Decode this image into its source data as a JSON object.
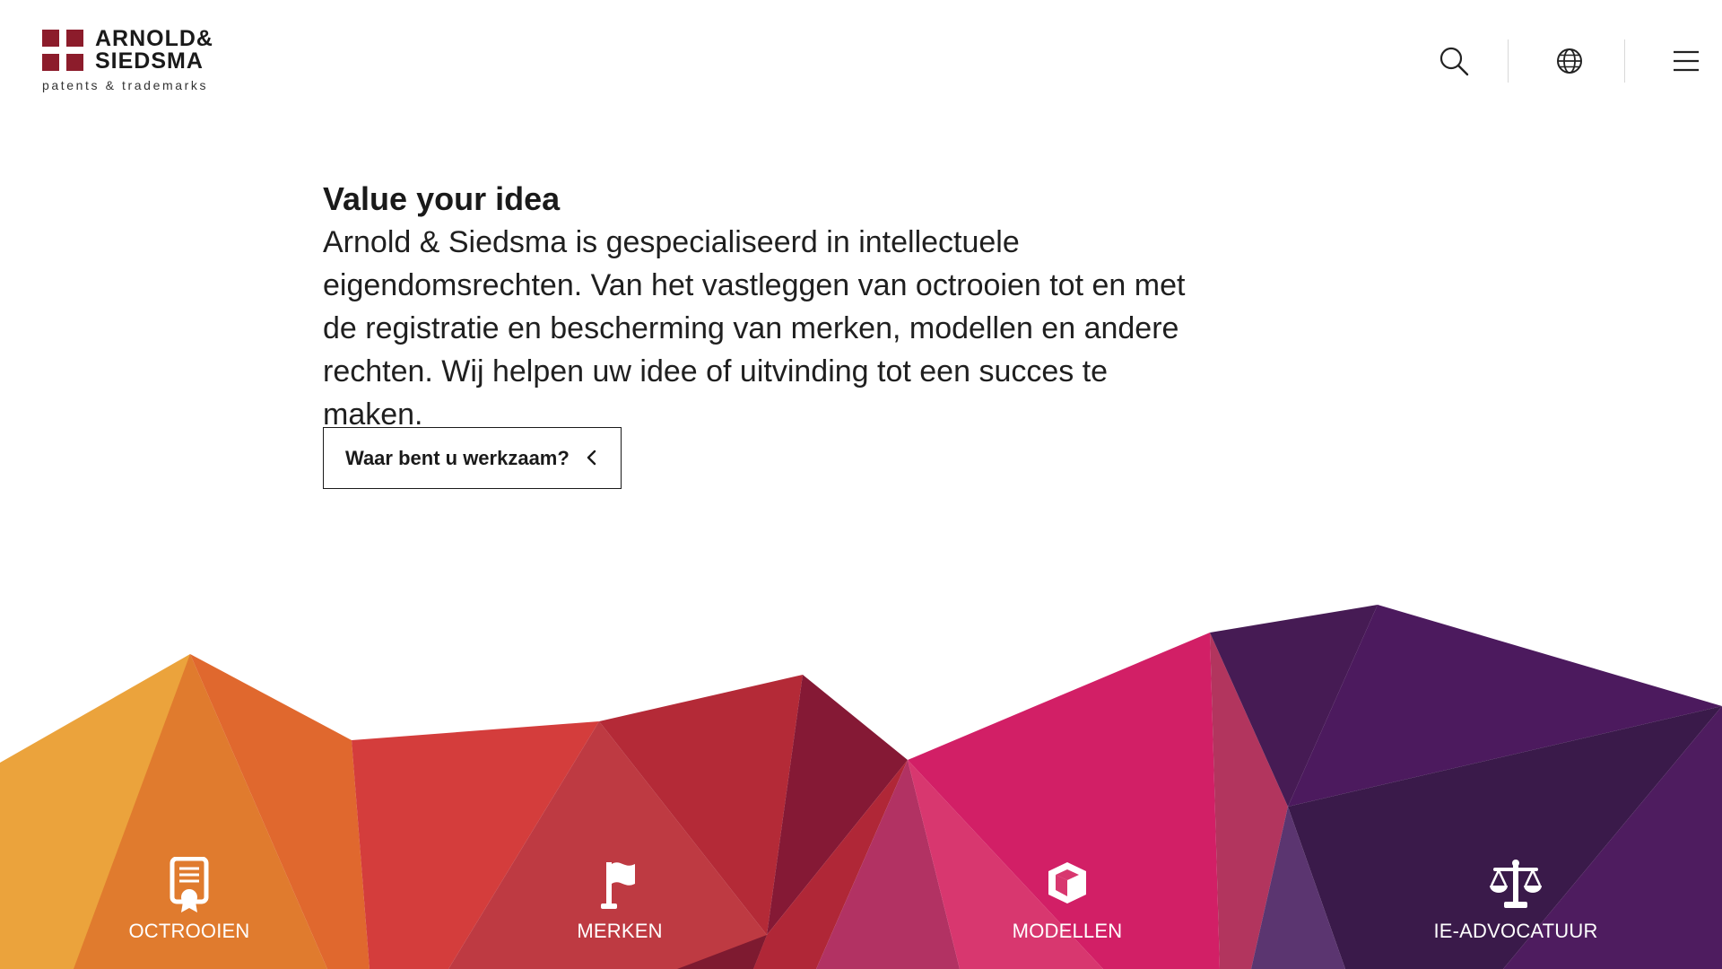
{
  "brand": {
    "name_line1": "ARNOLD&",
    "name_line2": "SIEDSMA",
    "tagline": "patents & trademarks",
    "color": "#8c1c2b"
  },
  "header": {
    "icons": [
      "search-icon",
      "globe-icon",
      "menu-icon"
    ]
  },
  "intro": {
    "title": "Value your idea",
    "body": "Arnold & Siedsma is gespecialiseerd in intellectuele eigendomsrechten. Van het vastleggen van octrooien tot en met de registratie en bescherming van merken, modellen en andere rechten. Wij helpen uw idee of uitvinding tot een succes te maken."
  },
  "cta": {
    "label": "Waar bent u werkzaam?",
    "icon": "chevron-left-icon"
  },
  "categories": [
    {
      "label": "OCTROOIEN",
      "icon": "certificate-icon"
    },
    {
      "label": "MERKEN",
      "icon": "flag-icon"
    },
    {
      "label": "MODELLEN",
      "icon": "cube-icon"
    },
    {
      "label": "IE-ADVOCATUUR",
      "icon": "scales-icon"
    }
  ],
  "palette": {
    "orange": "#eba33c",
    "red": "#d43d3c",
    "magenta": "#d21f66",
    "purple": "#4c1a5e"
  }
}
